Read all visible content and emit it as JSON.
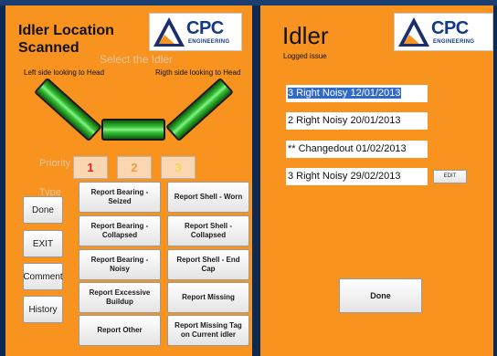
{
  "left": {
    "title": "Idler Location Scanned",
    "select_label": "Select the Idler",
    "left_side_label": "Left side looking to Head",
    "right_side_label": "Rigth side looking to Head",
    "priority_label": "Priority",
    "priorities": [
      {
        "label": "1",
        "color": "#e0202a"
      },
      {
        "label": "2",
        "color": "#e8a23a"
      },
      {
        "label": "3",
        "color": "#f3d94a"
      }
    ],
    "type_label": "Type",
    "side_buttons": [
      "Done",
      "EXIT",
      "Comment",
      "History"
    ],
    "report_buttons": [
      "Report Bearing - Seized",
      "Report Shell - Worn",
      "Report Bearing - Collapsed",
      "Report  Shell - Collapsed",
      "Report Bearing - Noisy",
      "Report Shell - End Cap",
      "Report Excessive Buildup",
      "Report Missing",
      "Report Other",
      "Report Missing Tag on Current idler"
    ]
  },
  "logo": {
    "brand": "CPC",
    "sub": "ENGINEERING",
    "brand_color": "#123a86",
    "triangle_color": "#1b2f6e",
    "accent_color": "#f7931e"
  },
  "right": {
    "title": "Idler",
    "subtitle": "Logged issue",
    "entries": [
      "3 Right Noisy 12/01/2013",
      "2 Right Noisy 20/01/2013",
      "** Changedout 01/02/2013",
      "3 Right Noisy 29/02/2013"
    ],
    "edit_label": "EDIT",
    "done_label": "Done"
  }
}
